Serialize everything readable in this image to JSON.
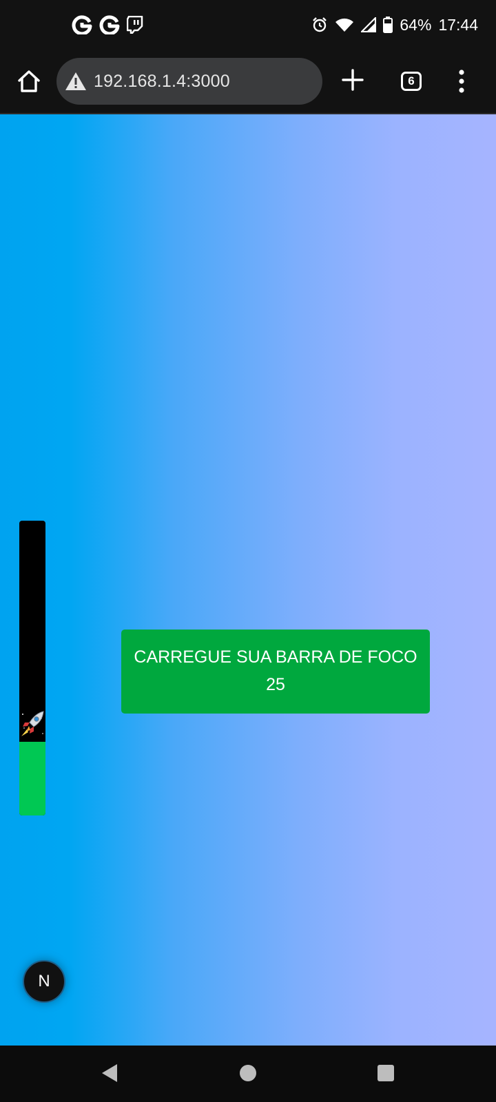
{
  "status_bar": {
    "left_icons": [
      "g-letter-icon",
      "g-letter-icon",
      "twitch-icon"
    ],
    "right_icons": [
      "alarm-icon",
      "wifi-icon",
      "signal-icon",
      "battery-icon"
    ],
    "battery": "64%",
    "time": "17:44"
  },
  "browser": {
    "url": "192.168.1.4:3000",
    "tab_count": "6",
    "icons": [
      "home-icon",
      "warning-icon",
      "plus-icon",
      "more-vert-icon"
    ]
  },
  "focus_bar": {
    "fill_fraction": 0.25,
    "marker_icon": "rocket-icon",
    "colors": {
      "track": "#000000",
      "fill": "#00c853"
    }
  },
  "card": {
    "title": "CARREGUE SUA BARRA DE FOCO",
    "count": "25",
    "color": "#00a83e"
  },
  "floating_badge": {
    "label": "N"
  },
  "nav_bar": {
    "icons": [
      "back-icon",
      "home-circle-icon",
      "recents-icon"
    ]
  },
  "colors": {
    "gradient_start": "#00a3f0",
    "gradient_end": "#a6b4ff"
  }
}
